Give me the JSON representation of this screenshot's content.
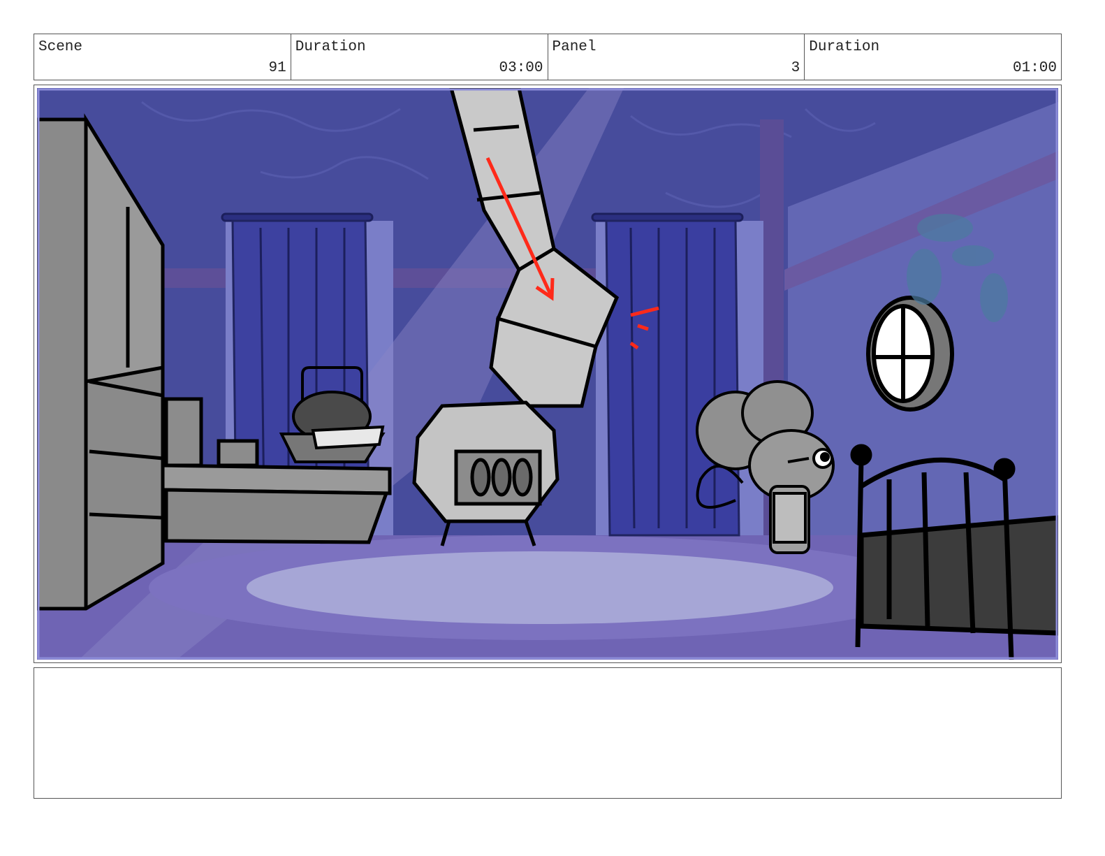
{
  "header": {
    "scene_label": "Scene",
    "scene_value": "91",
    "scene_duration_label": "Duration",
    "scene_duration_value": "03:00",
    "panel_label": "Panel",
    "panel_value": "3",
    "panel_duration_label": "Duration",
    "panel_duration_value": "01:00"
  },
  "panel_image": {
    "description_icons": [
      "cupboard",
      "basket",
      "wood-stove",
      "stovepipe",
      "curtain",
      "mouse-character",
      "round-window",
      "bed-frame",
      "motion-arrow"
    ]
  },
  "notes": {
    "text": ""
  },
  "colors": {
    "wall": "#4a4fa0",
    "curtain": "#3b3f9a",
    "floor": "#6a5fb0",
    "rug": "#9a9ad0",
    "sketch_gray": "#a8a8a8",
    "arrow_red": "#ff2a1a"
  }
}
